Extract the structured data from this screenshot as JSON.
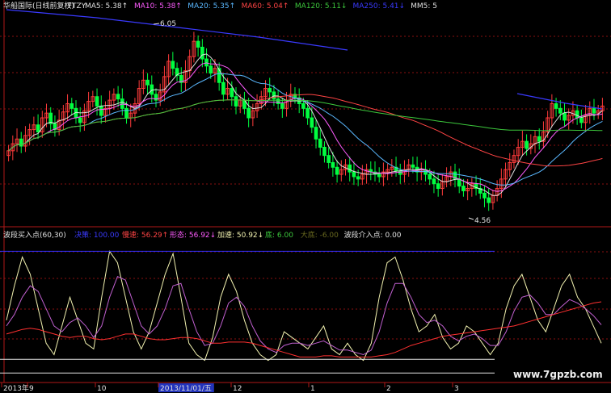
{
  "colors": {
    "background": "#000000",
    "up_candle": "#ff3b3b",
    "down_candle": "#00ff40",
    "grid": "#8a1010",
    "border": "#b01818",
    "ma5": "#e0e0e0",
    "ma10": "#ff5cff",
    "ma20": "#5ab8ff",
    "ma60": "#ff4444",
    "ma120": "#3cc83c",
    "ma250": "#3a3aff",
    "osc_fast": "#f2f2b0",
    "osc_slow": "#c060d0",
    "osc_base": "#ff3030",
    "osc_blue": "#3030ff",
    "date_marker_bg": "#2233bb"
  },
  "header": {
    "stock": "华船国际(日线前复权)",
    "code": "FTZY",
    "ma_labels": [
      {
        "text": "MA5: 5.38",
        "arrow": "↑",
        "color": "#e0e0e0"
      },
      {
        "text": "MA10: 5.38",
        "arrow": "↑",
        "color": "#ff5cff"
      },
      {
        "text": "MA20: 5.35",
        "arrow": "↑",
        "color": "#5ab8ff"
      },
      {
        "text": "MA60: 5.04",
        "arrow": "↑",
        "color": "#ff4444"
      },
      {
        "text": "MA120: 5.11",
        "arrow": "↓",
        "color": "#3cc83c"
      },
      {
        "text": "MA250: 5.41",
        "arrow": "↓",
        "color": "#3a3aff"
      },
      {
        "text": "MM5: 5",
        "arrow": "",
        "color": "#e0e0e0"
      }
    ]
  },
  "indicator": {
    "name": "波段买入点(60,30)",
    "values": [
      {
        "text": "决策: 100.00",
        "color": "#3a3aff"
      },
      {
        "text": "慢速: 56.29",
        "arrow": "↑",
        "color": "#ff4444"
      },
      {
        "text": "形态: 56.92",
        "arrow": "↓",
        "color": "#ff5cff"
      },
      {
        "text": "加速: 50.92",
        "arrow": "↓",
        "color": "#f2f2b0"
      },
      {
        "text": "底: 6.00",
        "color": "#3cc83c"
      },
      {
        "text": "大底: -6.00",
        "color": "#6a6a20"
      },
      {
        "text": "波段介入点: 0.00",
        "color": "#e0e0e0"
      }
    ]
  },
  "x_axis": {
    "labels": [
      "2013年",
      "9",
      "10",
      "2013/11/01/五",
      "12",
      "1",
      "2",
      "3"
    ],
    "highlighted": "2013/11/01/五"
  },
  "annotations": {
    "high": "6.05",
    "low": "4.56"
  },
  "watermark": "www.7gpzb.com",
  "chart_data": [
    {
      "type": "candlestick",
      "title": "华船国际(日线前复权)",
      "ohlc_sketch": {
        "close": [
          5.02,
          5.08,
          5.12,
          5.06,
          5.15,
          5.2,
          5.24,
          5.18,
          5.3,
          5.34,
          5.25,
          5.2,
          5.28,
          5.35,
          5.42,
          5.38,
          5.3,
          5.26,
          5.36,
          5.44,
          5.48,
          5.4,
          5.32,
          5.38,
          5.45,
          5.5,
          5.46,
          5.38,
          5.3,
          5.34,
          5.42,
          5.55,
          5.62,
          5.58,
          5.5,
          5.45,
          5.52,
          5.65,
          5.78,
          5.72,
          5.66,
          5.6,
          5.7,
          5.82,
          5.95,
          5.9,
          5.8,
          5.74,
          5.68,
          5.72,
          5.6,
          5.5,
          5.55,
          5.48,
          5.4,
          5.45,
          5.38,
          5.3,
          5.36,
          5.42,
          5.48,
          5.55,
          5.52,
          5.46,
          5.42,
          5.38,
          5.45,
          5.5,
          5.47,
          5.42,
          5.38,
          5.3,
          5.22,
          5.12,
          5.05,
          4.98,
          4.92,
          4.88,
          4.82,
          4.86,
          4.9,
          4.84,
          4.8,
          4.78,
          4.82,
          4.86,
          4.84,
          4.82,
          4.8,
          4.84,
          4.86,
          4.88,
          4.85,
          4.82,
          4.86,
          4.9,
          4.88,
          4.84,
          4.86,
          4.82,
          4.78,
          4.74,
          4.7,
          4.76,
          4.8,
          4.84,
          4.78,
          4.72,
          4.68,
          4.7,
          4.74,
          4.7,
          4.66,
          4.62,
          4.58,
          4.64,
          4.7,
          4.78,
          4.86,
          4.92,
          4.98,
          5.05,
          5.1,
          5.04,
          5.08,
          5.14,
          5.1,
          5.18,
          5.3,
          5.42,
          5.38,
          5.34,
          5.28,
          5.32,
          5.36,
          5.3,
          5.26,
          5.32,
          5.38,
          5.34,
          5.36,
          5.4
        ]
      },
      "high_label": 6.05,
      "low_label": 4.56,
      "moving_averages": [
        "MA5",
        "MA10",
        "MA20",
        "MA60",
        "MA120",
        "MA250"
      ]
    },
    {
      "type": "line",
      "title": "波段买入点(60,30)",
      "series": [
        {
          "name": "加速",
          "values": [
            40,
            70,
            95,
            80,
            50,
            20,
            10,
            35,
            60,
            40,
            20,
            15,
            60,
            100,
            90,
            60,
            30,
            15,
            30,
            55,
            80,
            98,
            60,
            20,
            10,
            5,
            25,
            60,
            80,
            65,
            40,
            20,
            10,
            5,
            10,
            30,
            25,
            20,
            15,
            25,
            35,
            15,
            10,
            20,
            10,
            5,
            20,
            60,
            90,
            95,
            75,
            50,
            30,
            35,
            45,
            25,
            15,
            20,
            35,
            30,
            20,
            10,
            20,
            50,
            70,
            80,
            60,
            40,
            30,
            50,
            70,
            80,
            60,
            50,
            35,
            20
          ]
        },
        {
          "name": "形态",
          "values": [
            35,
            45,
            60,
            70,
            65,
            50,
            35,
            30,
            38,
            42,
            35,
            25,
            35,
            60,
            78,
            75,
            55,
            35,
            28,
            35,
            50,
            70,
            72,
            50,
            30,
            18,
            20,
            35,
            55,
            60,
            52,
            35,
            22,
            15,
            12,
            18,
            20,
            20,
            18,
            20,
            22,
            18,
            14,
            14,
            12,
            10,
            14,
            30,
            55,
            72,
            72,
            60,
            45,
            38,
            40,
            35,
            26,
            22,
            26,
            28,
            24,
            18,
            18,
            30,
            48,
            60,
            62,
            55,
            45,
            45,
            52,
            58,
            55,
            50,
            44,
            36
          ]
        },
        {
          "name": "慢速",
          "values": [
            28,
            30,
            32,
            33,
            32,
            30,
            28,
            26,
            25,
            26,
            26,
            24,
            23,
            24,
            26,
            28,
            28,
            26,
            24,
            23,
            23,
            24,
            25,
            25,
            24,
            22,
            20,
            20,
            21,
            21,
            21,
            20,
            18,
            16,
            14,
            12,
            10,
            8,
            8,
            8,
            9,
            9,
            8,
            8,
            8,
            8,
            8,
            9,
            10,
            12,
            15,
            18,
            20,
            22,
            24,
            26,
            27,
            28,
            29,
            30,
            31,
            32,
            33,
            34,
            35,
            37,
            39,
            41,
            43,
            45,
            47,
            49,
            51,
            53,
            55,
            56
          ]
        }
      ],
      "levels": [
        {
          "name": "决策",
          "value": 100
        },
        {
          "name": "底",
          "value": 6
        },
        {
          "name": "大底",
          "value": -6
        }
      ]
    }
  ]
}
